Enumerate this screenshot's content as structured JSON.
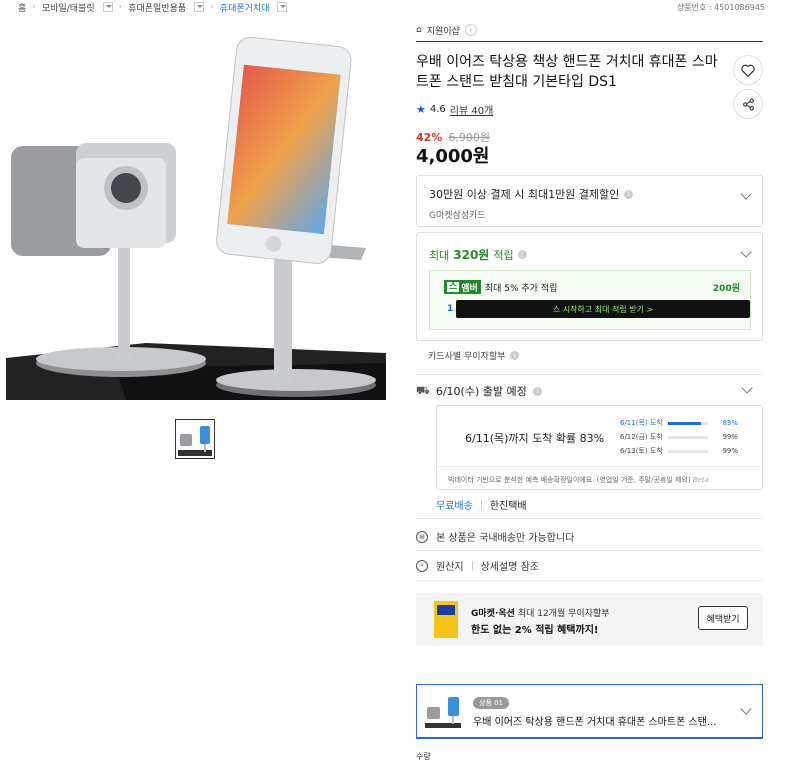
{
  "breadcrumb": {
    "items": [
      "홈",
      "모바일/태블릿",
      "휴대폰일반용품",
      "휴대폰거치대"
    ]
  },
  "product_number": "상품번호 : 4501086945",
  "shop": {
    "name": "지원이샵"
  },
  "product": {
    "title": "우배 이어즈 탁상용 책상 핸드폰 거치대 휴대폰 스마트폰 스탠드 받침대 기본타입 DS1",
    "rating": "4.6",
    "reviews": "리뷰 40개",
    "discount_pct": "42%",
    "original_price": "6,900원",
    "price": "4,000원"
  },
  "card_offer": {
    "title": "30만원 이상 결제 시 최대1만원 결제할인",
    "subtitle": "G마켓삼성카드"
  },
  "points": {
    "prefix": "최대",
    "amount": "320원",
    "suffix": "적립",
    "club_badge_k": "스",
    "club_badge": "멤버",
    "club_text": "최대 5% 추가 적립",
    "club_points": "200원",
    "club_step": "1",
    "club_button": "스 시작하고 최대 적립 받기 >"
  },
  "installment": "카드사별 무이자할부",
  "shipping": {
    "depart": "6/10(수) 출발 예정",
    "prediction_main": "6/11(목)까지 도착 확률 83%",
    "rows": [
      {
        "date": "6/11(목) 도착",
        "pct": "83%",
        "value": 0.83
      },
      {
        "date": "6/12(금) 도착",
        "pct": "99%",
        "value": 0.99
      },
      {
        "date": "6/13(토) 도착",
        "pct": "99%",
        "value": 0.99
      }
    ],
    "note": "빅데이터 기반으로 분석한 예측 배송확정일이에요. (영업일 기준, 주말/공휴일 제외)",
    "note_beta": "Beta",
    "fee": "무료배송",
    "carrier": "한진택배"
  },
  "domestic_only": "본 상품은 국내배송만 가능합니다",
  "origin": {
    "label": "원산지",
    "value": "상세설명 참조"
  },
  "banner": {
    "line1_brand": "G마켓·옥션",
    "line1_rest": "최대 12개월 무이자할부",
    "line2": "한도 없는 2% 적립 혜택까지!",
    "button": "혜택받기"
  },
  "option": {
    "tag": "상품 01",
    "name": "우배 이어즈 탁상용 핸드폰 거치대 휴대폰 스마트폰 스탠..."
  },
  "quantity_label": "수량"
}
